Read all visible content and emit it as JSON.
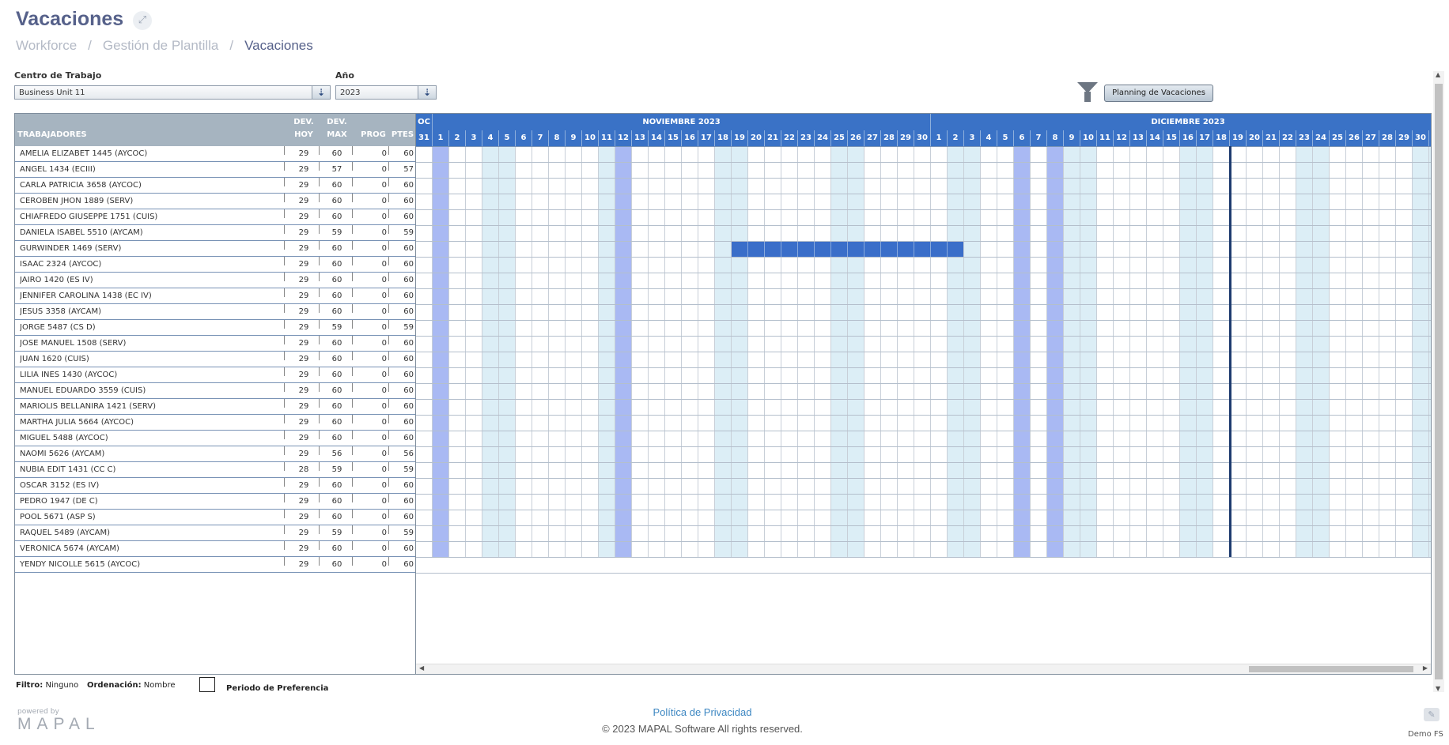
{
  "page": {
    "title": "Vacaciones",
    "expand_icon": "expand-icon",
    "breadcrumb": [
      "Workforce",
      "Gestión de Plantilla",
      "Vacaciones"
    ],
    "breadcrumb_sep": "/"
  },
  "filters": {
    "centro_label": "Centro de Trabajo",
    "centro_value": "Business Unit 11",
    "anio_label": "Año",
    "anio_value": "2023",
    "planning_button": "Planning de Vacaciones"
  },
  "table": {
    "headers": {
      "trabajadores": "TRABAJADORES",
      "dev_hoy_1": "DEV.",
      "dev_hoy_2": "HOY",
      "dev_max_1": "DEV.",
      "dev_max_2": "MAX",
      "prog": "PROG",
      "ptes": "PTES"
    },
    "rows": [
      {
        "name": "AMELIA ELIZABET 1445 (AYCOC)",
        "dev_hoy": "29",
        "dev_max": "60",
        "prog": "0",
        "ptes": "60"
      },
      {
        "name": "ANGEL 1434 (ECIII)",
        "dev_hoy": "29",
        "dev_max": "57",
        "prog": "0",
        "ptes": "57"
      },
      {
        "name": "CARLA PATRICIA 3658 (AYCOC)",
        "dev_hoy": "29",
        "dev_max": "60",
        "prog": "0",
        "ptes": "60"
      },
      {
        "name": "CEROBEN JHON 1889 (SERV)",
        "dev_hoy": "29",
        "dev_max": "60",
        "prog": "0",
        "ptes": "60"
      },
      {
        "name": "CHIAFREDO GIUSEPPE 1751 (CUIS)",
        "dev_hoy": "29",
        "dev_max": "60",
        "prog": "0",
        "ptes": "60"
      },
      {
        "name": "DANIELA ISABEL 5510 (AYCAM)",
        "dev_hoy": "29",
        "dev_max": "59",
        "prog": "0",
        "ptes": "59"
      },
      {
        "name": "GURWINDER 1469 (SERV)",
        "dev_hoy": "29",
        "dev_max": "60",
        "prog": "0",
        "ptes": "60"
      },
      {
        "name": "ISAAC 2324 (AYCOC)",
        "dev_hoy": "29",
        "dev_max": "60",
        "prog": "0",
        "ptes": "60"
      },
      {
        "name": "JAIRO 1420 (ES IV)",
        "dev_hoy": "29",
        "dev_max": "60",
        "prog": "0",
        "ptes": "60"
      },
      {
        "name": "JENNIFER CAROLINA 1438 (EC IV)",
        "dev_hoy": "29",
        "dev_max": "60",
        "prog": "0",
        "ptes": "60"
      },
      {
        "name": "JESUS 3358 (AYCAM)",
        "dev_hoy": "29",
        "dev_max": "60",
        "prog": "0",
        "ptes": "60"
      },
      {
        "name": "JORGE 5487 (CS D)",
        "dev_hoy": "29",
        "dev_max": "59",
        "prog": "0",
        "ptes": "59"
      },
      {
        "name": "JOSE MANUEL 1508 (SERV)",
        "dev_hoy": "29",
        "dev_max": "60",
        "prog": "0",
        "ptes": "60"
      },
      {
        "name": "JUAN 1620 (CUIS)",
        "dev_hoy": "29",
        "dev_max": "60",
        "prog": "0",
        "ptes": "60"
      },
      {
        "name": "LILIA INES 1430 (AYCOC)",
        "dev_hoy": "29",
        "dev_max": "60",
        "prog": "0",
        "ptes": "60"
      },
      {
        "name": "MANUEL EDUARDO 3559 (CUIS)",
        "dev_hoy": "29",
        "dev_max": "60",
        "prog": "0",
        "ptes": "60"
      },
      {
        "name": "MARIOLIS BELLANIRA 1421 (SERV)",
        "dev_hoy": "29",
        "dev_max": "60",
        "prog": "0",
        "ptes": "60"
      },
      {
        "name": "MARTHA JULIA 5664 (AYCOC)",
        "dev_hoy": "29",
        "dev_max": "60",
        "prog": "0",
        "ptes": "60"
      },
      {
        "name": "MIGUEL 5488 (AYCOC)",
        "dev_hoy": "29",
        "dev_max": "60",
        "prog": "0",
        "ptes": "60"
      },
      {
        "name": "NAOMI 5626 (AYCAM)",
        "dev_hoy": "29",
        "dev_max": "56",
        "prog": "0",
        "ptes": "56"
      },
      {
        "name": "NUBIA EDIT 1431 (CC C)",
        "dev_hoy": "28",
        "dev_max": "59",
        "prog": "0",
        "ptes": "59"
      },
      {
        "name": "OSCAR 3152 (ES IV)",
        "dev_hoy": "29",
        "dev_max": "60",
        "prog": "0",
        "ptes": "60"
      },
      {
        "name": "PEDRO 1947 (DE C)",
        "dev_hoy": "29",
        "dev_max": "60",
        "prog": "0",
        "ptes": "60"
      },
      {
        "name": "POOL 5671 (ASP S)",
        "dev_hoy": "29",
        "dev_max": "60",
        "prog": "0",
        "ptes": "60"
      },
      {
        "name": "RAQUEL 5489 (AYCAM)",
        "dev_hoy": "29",
        "dev_max": "59",
        "prog": "0",
        "ptes": "59"
      },
      {
        "name": "VERONICA 5674 (AYCAM)",
        "dev_hoy": "29",
        "dev_max": "60",
        "prog": "0",
        "ptes": "60"
      },
      {
        "name": "YENDY NICOLLE 5615 (AYCOC)",
        "dev_hoy": "29",
        "dev_max": "60",
        "prog": "0",
        "ptes": "60"
      }
    ]
  },
  "calendar": {
    "months": [
      {
        "label": "OC",
        "days": [
          31
        ]
      },
      {
        "label": "NOVIEMBRE 2023",
        "days": [
          1,
          2,
          3,
          4,
          5,
          6,
          7,
          8,
          9,
          10,
          11,
          12,
          13,
          14,
          15,
          16,
          17,
          18,
          19,
          20,
          21,
          22,
          23,
          24,
          25,
          26,
          27,
          28,
          29,
          30
        ]
      },
      {
        "label": "DICIEMBRE 2023",
        "days": [
          1,
          2,
          3,
          4,
          5,
          6,
          7,
          8,
          9,
          10,
          11,
          12,
          13,
          14,
          15,
          16,
          17,
          18,
          19,
          20,
          21,
          22,
          23,
          24,
          25,
          26,
          27,
          28,
          29,
          30,
          31
        ]
      }
    ],
    "weekend_days": [
      "11-4",
      "11-5",
      "11-11",
      "11-18",
      "11-19",
      "11-25",
      "11-26",
      "12-2",
      "12-3",
      "12-9",
      "12-10",
      "12-16",
      "12-17",
      "12-23",
      "12-24",
      "12-30",
      "12-31"
    ],
    "holiday_days": [
      "11-1",
      "11-12",
      "12-6",
      "12-8"
    ],
    "today": "12-19",
    "vacation": {
      "worker_row": 6,
      "from": "11-19",
      "to": "12-2"
    },
    "colors": {
      "header": "#3a72c6",
      "weekend": "#dceef6",
      "holiday": "#a9b9f3",
      "vacation": "#3a6ec9",
      "today_line": "#1e3b6f"
    }
  },
  "footer_bar": {
    "filtro_label": "Filtro:",
    "filtro_value": "Ninguno",
    "orden_label": "Ordenación:",
    "orden_value": "Nombre",
    "legend_label": "Periodo de Preferencia"
  },
  "footer": {
    "powered_by": "powered by",
    "logo_text": "MAPAL",
    "privacy": "Política de Privacidad",
    "copyright": "© 2023 MAPAL Software All rights reserved.",
    "user": "Demo FS",
    "user_icon": "user-signature-icon"
  }
}
